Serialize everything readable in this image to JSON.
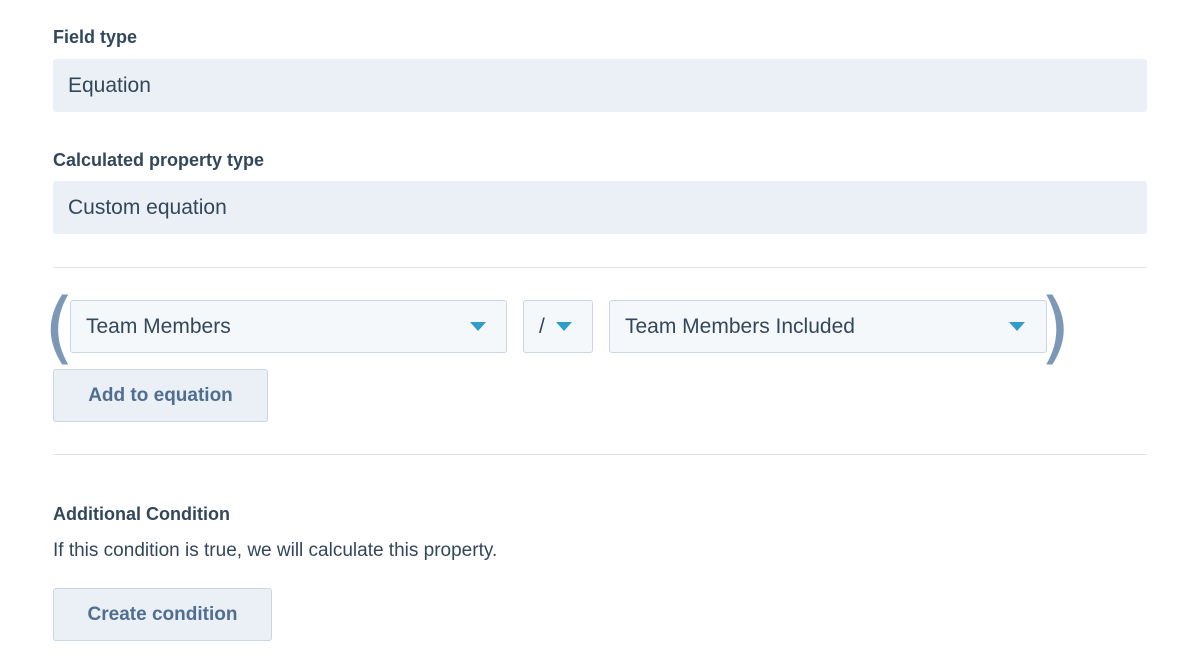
{
  "field_type": {
    "label": "Field type",
    "value": "Equation"
  },
  "calculated_property_type": {
    "label": "Calculated property type",
    "value": "Custom equation"
  },
  "equation": {
    "open_paren": "(",
    "close_paren": ")",
    "left_operand": "Team Members",
    "operator": "/",
    "right_operand": "Team Members Included",
    "add_button_label": "Add to equation"
  },
  "additional_condition": {
    "title": "Additional Condition",
    "description": "If this condition is true, we will calculate this property.",
    "create_button_label": "Create condition"
  },
  "colors": {
    "accent_caret": "#2f9dc6",
    "field_background": "#eaf0f6",
    "text": "#33475b"
  }
}
